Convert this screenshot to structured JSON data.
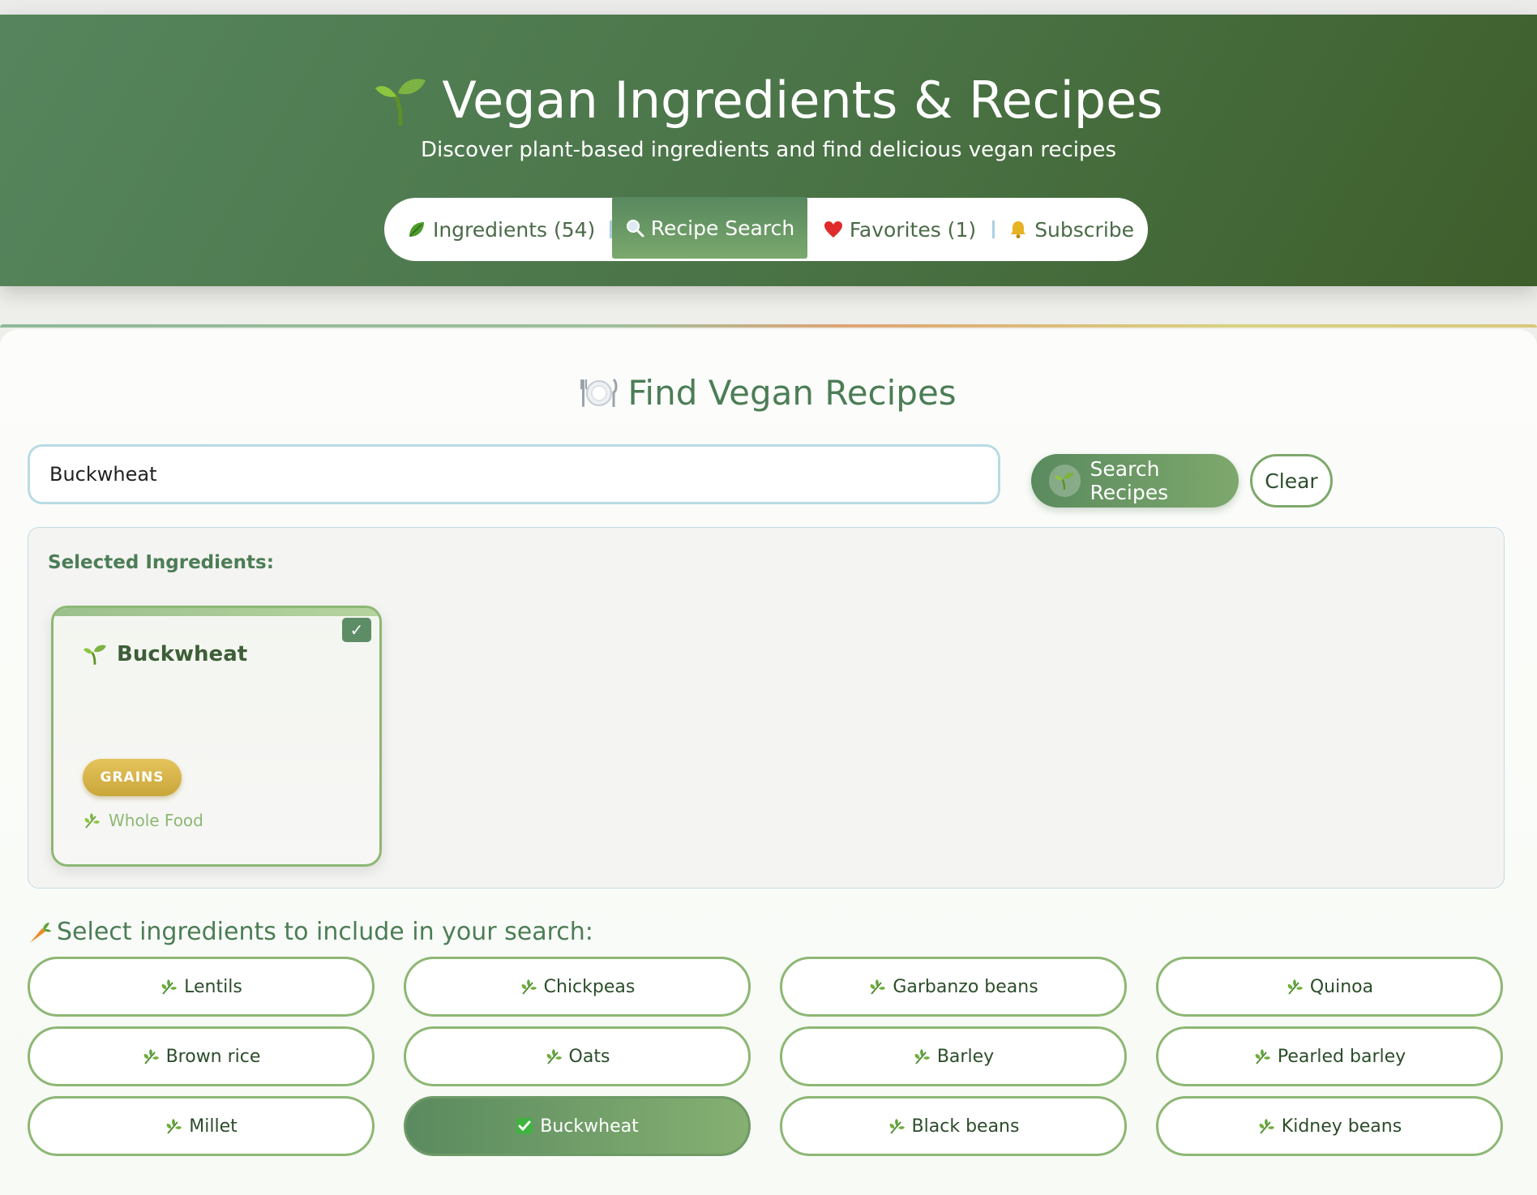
{
  "header": {
    "title": "Vegan Ingredients & Recipes",
    "subtitle": "Discover plant-based ingredients and find delicious vegan recipes",
    "tabs": [
      {
        "icon": "leaf-icon",
        "label": "Ingredients (54)"
      },
      {
        "icon": "magnifier-icon",
        "label": "Recipe Search",
        "active": true
      },
      {
        "icon": "heart-icon",
        "label": "Favorites (1)"
      },
      {
        "icon": "bell-icon",
        "label": "Subscribe"
      }
    ]
  },
  "search": {
    "title": "Find Vegan Recipes",
    "input_value": "Buckwheat",
    "search_button": "Search Recipes",
    "clear_button": "Clear"
  },
  "selected": {
    "label": "Selected Ingredients:",
    "card": {
      "name": "Buckwheat",
      "category": "GRAINS",
      "tag": "Whole Food",
      "check": "✓"
    }
  },
  "ingredients": {
    "title": "Select ingredients to include in your search:",
    "items": [
      {
        "label": "Lentils",
        "selected": false
      },
      {
        "label": "Chickpeas",
        "selected": false
      },
      {
        "label": "Garbanzo beans",
        "selected": false
      },
      {
        "label": "Quinoa",
        "selected": false
      },
      {
        "label": "Brown rice",
        "selected": false
      },
      {
        "label": "Oats",
        "selected": false
      },
      {
        "label": "Barley",
        "selected": false
      },
      {
        "label": "Pearled barley",
        "selected": false
      },
      {
        "label": "Millet",
        "selected": false
      },
      {
        "label": "Buckwheat",
        "selected": true
      },
      {
        "label": "Black beans",
        "selected": false
      },
      {
        "label": "Kidney beans",
        "selected": false
      }
    ]
  },
  "colors": {
    "header_green": "#4b7548",
    "accent_green": "#5a8a5f",
    "border_green": "#8db774",
    "grains_badge": "#d9b74a",
    "input_border": "#b9dbe4"
  }
}
